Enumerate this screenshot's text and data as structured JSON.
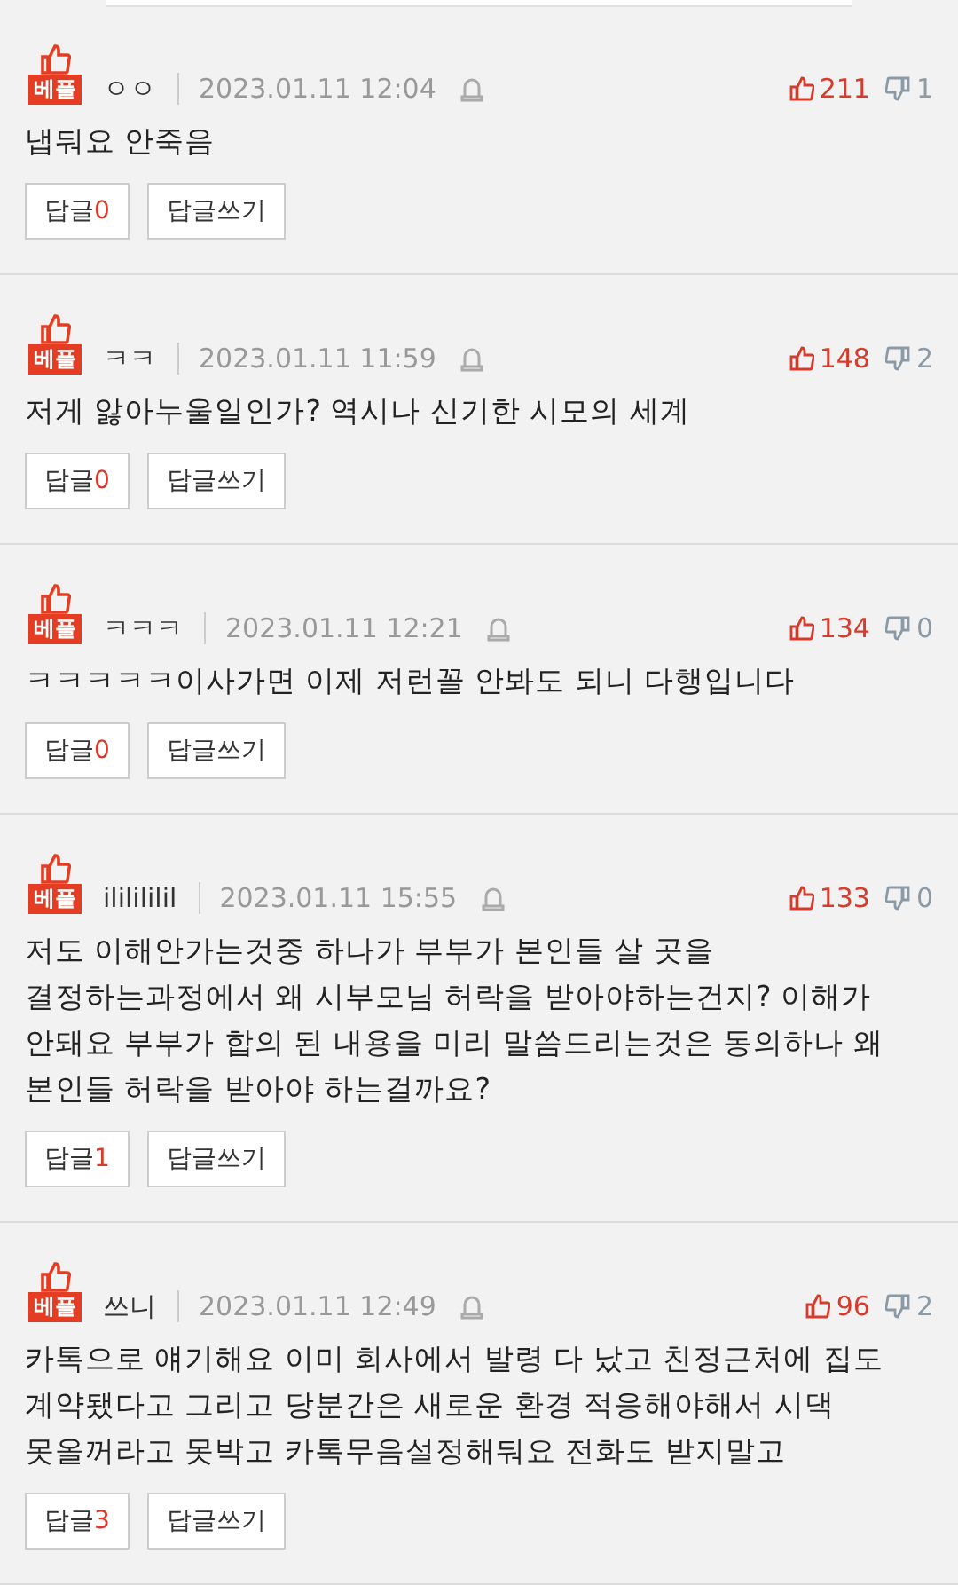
{
  "comments": [
    {
      "badge": "베플",
      "nickname": "ㅇㅇ",
      "date": "2023.01.11 12:04",
      "likes": "211",
      "dislikes": "1",
      "body": "냅둬요 안죽음",
      "reply_label": "답글",
      "reply_count": "0",
      "write_label": "답글쓰기"
    },
    {
      "badge": "베플",
      "nickname": "ㅋㅋ",
      "date": "2023.01.11 11:59",
      "likes": "148",
      "dislikes": "2",
      "body": "저게 앓아누울일인가? 역시나 신기한 시모의 세계",
      "reply_label": "답글",
      "reply_count": "0",
      "write_label": "답글쓰기"
    },
    {
      "badge": "베플",
      "nickname": "ㅋㅋㅋ",
      "date": "2023.01.11 12:21",
      "likes": "134",
      "dislikes": "0",
      "body": "ㅋㅋㅋㅋㅋ이사가면 이제 저런꼴 안봐도 되니 다행입니다",
      "reply_label": "답글",
      "reply_count": "0",
      "write_label": "답글쓰기"
    },
    {
      "badge": "베플",
      "nickname": "ililililil",
      "date": "2023.01.11 15:55",
      "likes": "133",
      "dislikes": "0",
      "body": "저도 이해안가는것중 하나가 부부가 본인들 살 곳을 결정하는과정에서 왜 시부모님 허락을 받아야하는건지? 이해가 안돼요 부부가 합의 된 내용을 미리 말씀드리는것은 동의하나 왜 본인들 허락을 받아야 하는걸까요?",
      "reply_label": "답글",
      "reply_count": "1",
      "write_label": "답글쓰기"
    },
    {
      "badge": "베플",
      "nickname": "쓰니",
      "date": "2023.01.11 12:49",
      "likes": "96",
      "dislikes": "2",
      "body": "카톡으로 얘기해요 이미 회사에서 발령 다 났고 친정근처에 집도 계약됐다고 그리고 당분간은 새로운 환경 적응해야해서 시댁 못올꺼라고 못박고 카톡무음설정해둬요 전화도 받지말고",
      "reply_label": "답글",
      "reply_count": "3",
      "write_label": "답글쓰기"
    }
  ]
}
